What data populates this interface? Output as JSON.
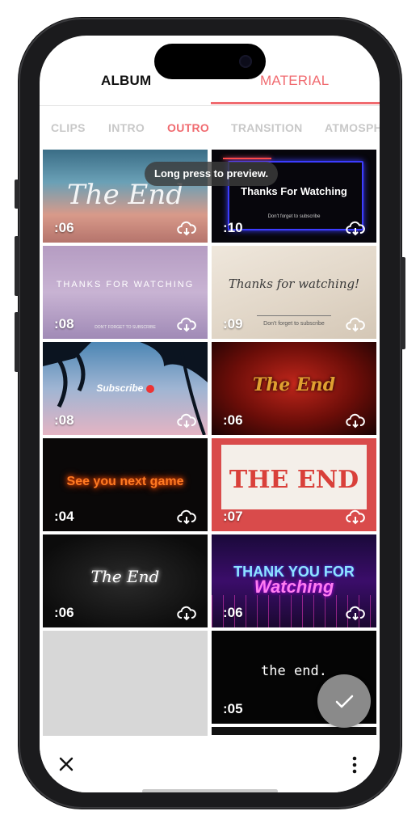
{
  "top_tabs": {
    "album": "ALBUM",
    "material": "MATERIAL",
    "selected": "MATERIAL"
  },
  "categories": [
    "CLIPS",
    "INTRO",
    "OUTRO",
    "TRANSITION",
    "ATMOSPH"
  ],
  "selected_category": "OUTRO",
  "tooltip": "Long press to preview.",
  "tiles": [
    {
      "duration": ":06",
      "caption": "The End"
    },
    {
      "duration": ":10",
      "caption": "Thanks For Watching",
      "subcaption": "Don't forget to subscribe"
    },
    {
      "duration": ":08",
      "caption": "THANKS FOR WATCHING",
      "subcaption": "DON'T FORGET TO SUBSCRIBE"
    },
    {
      "duration": ":09",
      "caption": "Thanks for watching!",
      "subcaption": "Don't forget to subscribe"
    },
    {
      "duration": ":08",
      "caption": "Subscribe"
    },
    {
      "duration": ":06",
      "caption": "The End"
    },
    {
      "duration": ":04",
      "caption": "See you next game"
    },
    {
      "duration": ":07",
      "caption": "THE END"
    },
    {
      "duration": ":06",
      "caption": "The End"
    },
    {
      "duration": ":06",
      "caption": "THANK YOU FOR",
      "subcaption": "Watching"
    },
    {
      "duration": "",
      "caption": ""
    },
    {
      "duration": ":05",
      "caption": "the end."
    }
  ],
  "icons": {
    "download": "cloud-download-icon",
    "confirm": "check-icon",
    "close": "close-icon",
    "more": "more-vertical-icon"
  },
  "colors": {
    "accent": "#f06a6f",
    "inactive_tab": "#c8c8c8",
    "fab": "#8a8a8a"
  }
}
